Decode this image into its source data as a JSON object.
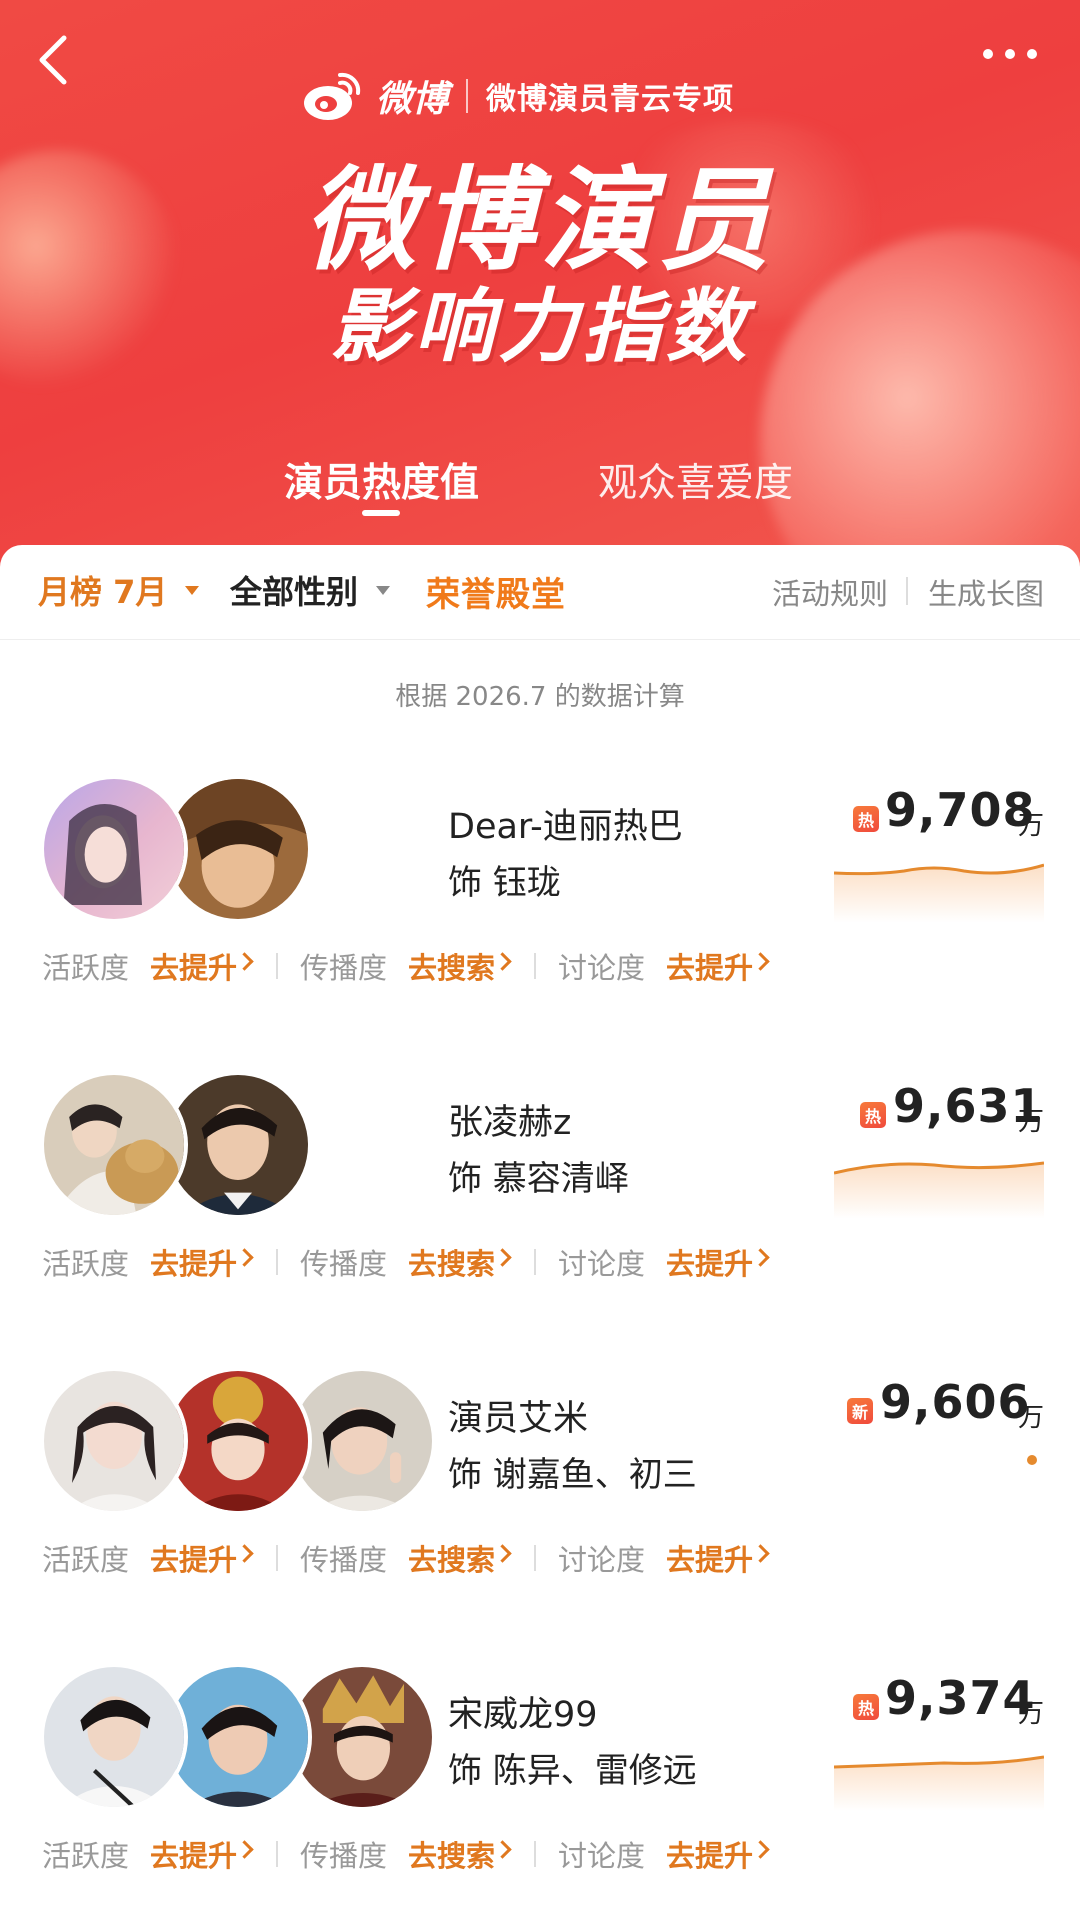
{
  "header": {
    "brand": "微博",
    "subtitle": "微博演员青云专项",
    "title_line1": "微博演员",
    "title_line2": "影响力指数",
    "back_icon": "chevron-left-icon",
    "more_icon": "more-dots-icon"
  },
  "tabs": [
    {
      "label": "演员热度值",
      "active": true
    },
    {
      "label": "观众喜爱度",
      "active": false
    }
  ],
  "filters": {
    "month": "月榜 7月",
    "gender": "全部性别",
    "hall_of_fame": "荣誉殿堂",
    "rules": "活动规则",
    "generate": "生成长图"
  },
  "calc_note": "根据 2026.7 的数据计算",
  "metric_labels": {
    "activity": "活跃度",
    "spread": "传播度",
    "discussion": "讨论度",
    "improve": "去提升",
    "search": "去搜索"
  },
  "entries": [
    {
      "name": "Dear-迪丽热巴",
      "role": "饰 钰珑",
      "badge": "热",
      "score": "9,708",
      "unit": "万",
      "trend": "line"
    },
    {
      "name": "张凌赫z",
      "role": "饰 慕容清峄",
      "badge": "热",
      "score": "9,631",
      "unit": "万",
      "trend": "line"
    },
    {
      "name": "演员艾米",
      "role": "饰 谢嘉鱼、初三",
      "badge": "新",
      "score": "9,606",
      "unit": "万",
      "trend": "dot"
    },
    {
      "name": "宋威龙99",
      "role": "饰 陈异、雷修远",
      "badge": "热",
      "score": "9,374",
      "unit": "万",
      "trend": "line"
    }
  ],
  "colors": {
    "banner_red": "#ee3f3f",
    "accent_orange": "#e0781f",
    "muted_gray": "#999999"
  }
}
